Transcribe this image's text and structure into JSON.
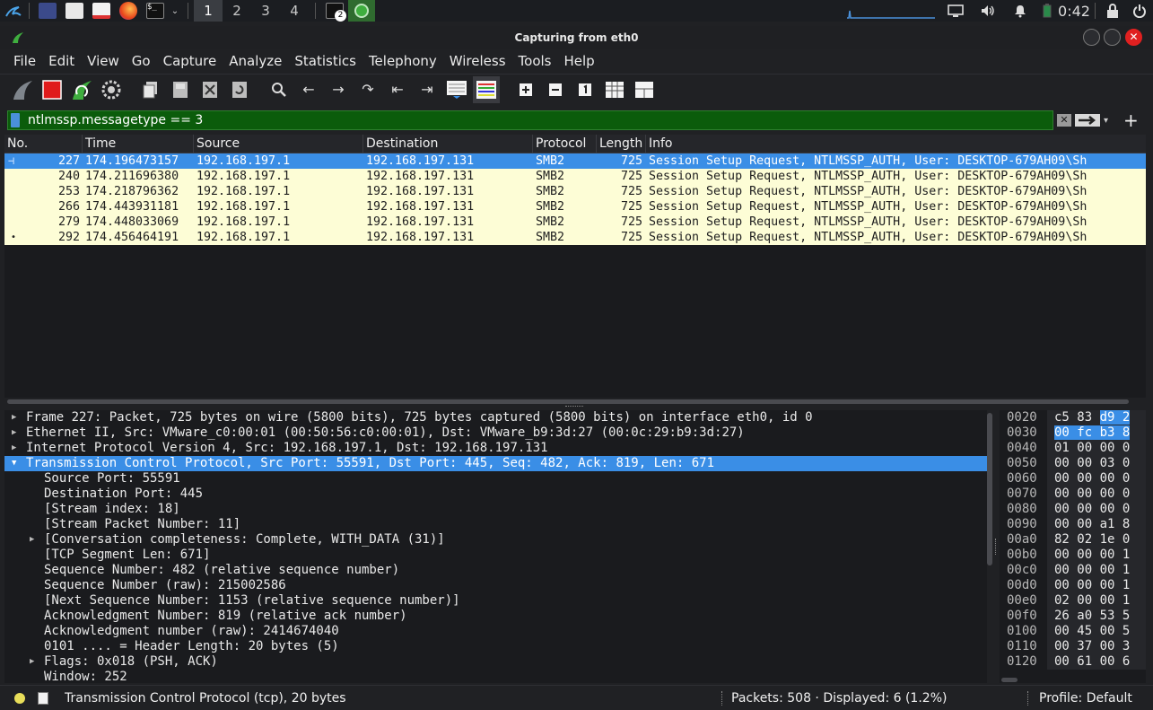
{
  "taskbar": {
    "workspaces": [
      "1",
      "2",
      "3",
      "4"
    ],
    "badge": "2",
    "clock": "0:42"
  },
  "window": {
    "title": "Capturing from eth0"
  },
  "menu": [
    "File",
    "Edit",
    "View",
    "Go",
    "Capture",
    "Analyze",
    "Statistics",
    "Telephony",
    "Wireless",
    "Tools",
    "Help"
  ],
  "filter": {
    "value": "ntlmssp.messagetype == 3",
    "add_label": "+"
  },
  "packet_list": {
    "columns": [
      "No.",
      "Time",
      "Source",
      "Destination",
      "Protocol",
      "Length",
      "Info"
    ],
    "rows": [
      [
        "227",
        "174.196473157",
        "192.168.197.1",
        "192.168.197.131",
        "SMB2",
        "725",
        "Session Setup Request, NTLMSSP_AUTH, User: DESKTOP-679AH09\\Sh"
      ],
      [
        "240",
        "174.211696380",
        "192.168.197.1",
        "192.168.197.131",
        "SMB2",
        "725",
        "Session Setup Request, NTLMSSP_AUTH, User: DESKTOP-679AH09\\Sh"
      ],
      [
        "253",
        "174.218796362",
        "192.168.197.1",
        "192.168.197.131",
        "SMB2",
        "725",
        "Session Setup Request, NTLMSSP_AUTH, User: DESKTOP-679AH09\\Sh"
      ],
      [
        "266",
        "174.443931181",
        "192.168.197.1",
        "192.168.197.131",
        "SMB2",
        "725",
        "Session Setup Request, NTLMSSP_AUTH, User: DESKTOP-679AH09\\Sh"
      ],
      [
        "279",
        "174.448033069",
        "192.168.197.1",
        "192.168.197.131",
        "SMB2",
        "725",
        "Session Setup Request, NTLMSSP_AUTH, User: DESKTOP-679AH09\\Sh"
      ],
      [
        "292",
        "174.456464191",
        "192.168.197.1",
        "192.168.197.131",
        "SMB2",
        "725",
        "Session Setup Request, NTLMSSP_AUTH, User: DESKTOP-679AH09\\Sh"
      ]
    ]
  },
  "details": [
    {
      "text": "Frame 227: Packet, 725 bytes on wire (5800 bits), 725 bytes captured (5800 bits) on interface eth0, id 0",
      "level": 0,
      "arrow": "right"
    },
    {
      "text": "Ethernet II, Src: VMware_c0:00:01 (00:50:56:c0:00:01), Dst: VMware_b9:3d:27 (00:0c:29:b9:3d:27)",
      "level": 0,
      "arrow": "right"
    },
    {
      "text": "Internet Protocol Version 4, Src: 192.168.197.1, Dst: 192.168.197.131",
      "level": 0,
      "arrow": "right"
    },
    {
      "text": "Transmission Control Protocol, Src Port: 55591, Dst Port: 445, Seq: 482, Ack: 819, Len: 671",
      "level": 0,
      "arrow": "down",
      "selected": true
    },
    {
      "text": "Source Port: 55591",
      "level": 1
    },
    {
      "text": "Destination Port: 445",
      "level": 1
    },
    {
      "text": "[Stream index: 18]",
      "level": 1
    },
    {
      "text": "[Stream Packet Number: 11]",
      "level": 1
    },
    {
      "text": "[Conversation completeness: Complete, WITH_DATA (31)]",
      "level": 1,
      "arrow": "right"
    },
    {
      "text": "[TCP Segment Len: 671]",
      "level": 1
    },
    {
      "text": "Sequence Number: 482    (relative sequence number)",
      "level": 1
    },
    {
      "text": "Sequence Number (raw): 215002586",
      "level": 1
    },
    {
      "text": "[Next Sequence Number: 1153    (relative sequence number)]",
      "level": 1
    },
    {
      "text": "Acknowledgment Number: 819    (relative ack number)",
      "level": 1
    },
    {
      "text": "Acknowledgment number (raw): 2414674040",
      "level": 1
    },
    {
      "text": "0101 .... = Header Length: 20 bytes (5)",
      "level": 1
    },
    {
      "text": "Flags: 0x018 (PSH, ACK)",
      "level": 1,
      "arrow": "right"
    },
    {
      "text": "Window: 252",
      "level": 1
    }
  ],
  "hex": [
    {
      "offset": "0020",
      "bytes": "c5 83 d9 2",
      "hl": "d9 2"
    },
    {
      "offset": "0030",
      "bytes": "00 fc b3 8",
      "hl": "all"
    },
    {
      "offset": "0040",
      "bytes": "01 00 00 0"
    },
    {
      "offset": "0050",
      "bytes": "00 00 03 0"
    },
    {
      "offset": "0060",
      "bytes": "00 00 00 0"
    },
    {
      "offset": "0070",
      "bytes": "00 00 00 0"
    },
    {
      "offset": "0080",
      "bytes": "00 00 00 0"
    },
    {
      "offset": "0090",
      "bytes": "00 00 a1 8"
    },
    {
      "offset": "00a0",
      "bytes": "82 02 1e 0"
    },
    {
      "offset": "00b0",
      "bytes": "00 00 00 1"
    },
    {
      "offset": "00c0",
      "bytes": "00 00 00 1"
    },
    {
      "offset": "00d0",
      "bytes": "00 00 00 1"
    },
    {
      "offset": "00e0",
      "bytes": "02 00 00 1"
    },
    {
      "offset": "00f0",
      "bytes": "26 a0 53 5"
    },
    {
      "offset": "0100",
      "bytes": "00 45 00 5"
    },
    {
      "offset": "0110",
      "bytes": "00 37 00 3"
    },
    {
      "offset": "0120",
      "bytes": "00 61 00 6"
    }
  ],
  "status": {
    "field": "Transmission Control Protocol (tcp), 20 bytes",
    "packets": "Packets: 508 · Displayed: 6 (1.2%)",
    "profile": "Profile: Default"
  },
  "colors": {
    "selection": "#3a8ee6",
    "row_bg": "#fdfdd6",
    "filter_ok": "#0b5c0b",
    "wireshark_fin": "#3fae3f"
  }
}
